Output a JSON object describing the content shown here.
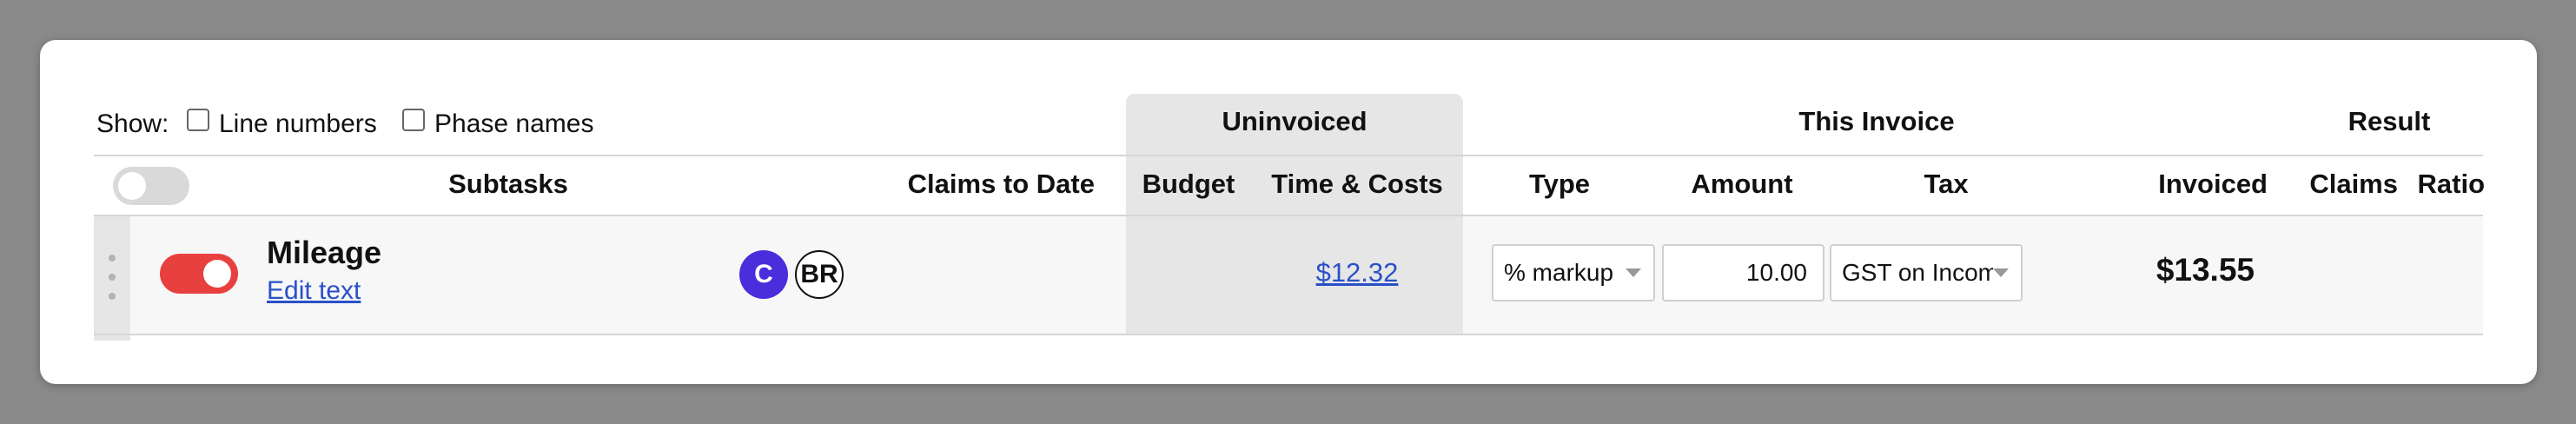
{
  "show": {
    "label": "Show:",
    "options": [
      {
        "label": "Line numbers",
        "checked": false
      },
      {
        "label": "Phase names",
        "checked": false
      }
    ]
  },
  "group_headers": {
    "uninvoiced": "Uninvoiced",
    "this_invoice": "This Invoice",
    "result": "Result"
  },
  "columns": {
    "subtasks": "Subtasks",
    "claims_to_date": "Claims to Date",
    "budget": "Budget",
    "time_costs": "Time & Costs",
    "type": "Type",
    "amount": "Amount",
    "tax": "Tax",
    "invoiced": "Invoiced",
    "claims": "Claims",
    "ratio": "Ratio"
  },
  "header_toggle": {
    "on": false
  },
  "row": {
    "toggle_on": true,
    "name": "Mileage",
    "edit_link": "Edit text",
    "avatars": [
      {
        "initials": "C",
        "bg": "#4a2ddb",
        "fg": "#ffffff"
      },
      {
        "initials": "BR",
        "bg": "#ffffff",
        "fg": "#111111"
      }
    ],
    "time_costs": "$12.32",
    "type": "% markup",
    "amount": "10.00",
    "tax": "GST on Income",
    "invoiced": "$13.55"
  },
  "colors": {
    "toggle_on": "#e8403f",
    "toggle_off": "#d9d9d9",
    "link": "#2a50c8"
  }
}
